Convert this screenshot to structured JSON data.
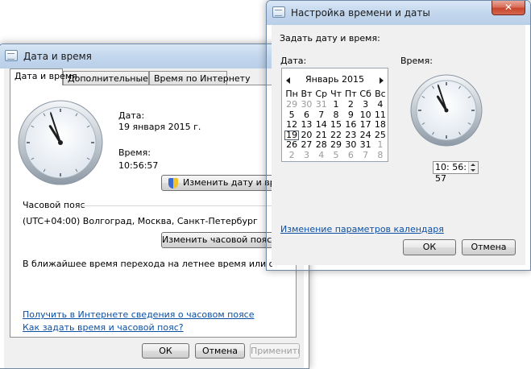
{
  "colors": {
    "link": "#0b4fa5",
    "titlebar": "#c4d8ee",
    "close": "#c7452b"
  },
  "main_window": {
    "title": "Дата и время",
    "tabs": [
      {
        "label": "Дата и время",
        "active": true
      },
      {
        "label": "Дополнительные часы",
        "active": false
      },
      {
        "label": "Время по Интернету",
        "active": false
      }
    ],
    "date_label": "Дата:",
    "date_value": "19 января 2015 г.",
    "time_label": "Время:",
    "time_value": "10:56:57",
    "change_datetime_button": "Изменить дату и время...",
    "timezone_section": "Часовой пояс",
    "timezone_value": "(UTC+04:00) Волгоград, Москва, Санкт-Петербург",
    "change_timezone_button": "Изменить часовой пояс...",
    "dst_note": "В ближайшее время перехода на летнее время или обратно не будет.",
    "links": {
      "timezone_info": "Получить в Интернете сведения о часовом поясе",
      "how_to_set": "Как задать время и часовой пояс?"
    },
    "buttons": {
      "ok": "ОК",
      "cancel": "Отмена",
      "apply": "Применить"
    }
  },
  "dialog": {
    "title": "Настройка времени и даты",
    "close_glyph": "✕",
    "instruction": "Задать дату и время:",
    "date_label": "Дата:",
    "time_label": "Время:",
    "calendar": {
      "month": "Январь 2015",
      "weekdays": [
        "Пн",
        "Вт",
        "Ср",
        "Чт",
        "Пт",
        "Сб",
        "Вс"
      ],
      "weeks": [
        [
          "29",
          "30",
          "31",
          "1",
          "2",
          "3",
          "4"
        ],
        [
          "5",
          "6",
          "7",
          "8",
          "9",
          "10",
          "11"
        ],
        [
          "12",
          "13",
          "14",
          "15",
          "16",
          "17",
          "18"
        ],
        [
          "19",
          "20",
          "21",
          "22",
          "23",
          "24",
          "25"
        ],
        [
          "26",
          "27",
          "28",
          "29",
          "30",
          "31",
          "1"
        ],
        [
          "2",
          "3",
          "4",
          "5",
          "6",
          "7",
          "8"
        ]
      ],
      "selected": "19"
    },
    "time_value": "10: 56: 57",
    "calendar_settings_link": "Изменение параметров календаря",
    "buttons": {
      "ok": "ОК",
      "cancel": "Отмена"
    }
  },
  "clock": {
    "hour": 10,
    "minute": 56,
    "second": 57
  }
}
